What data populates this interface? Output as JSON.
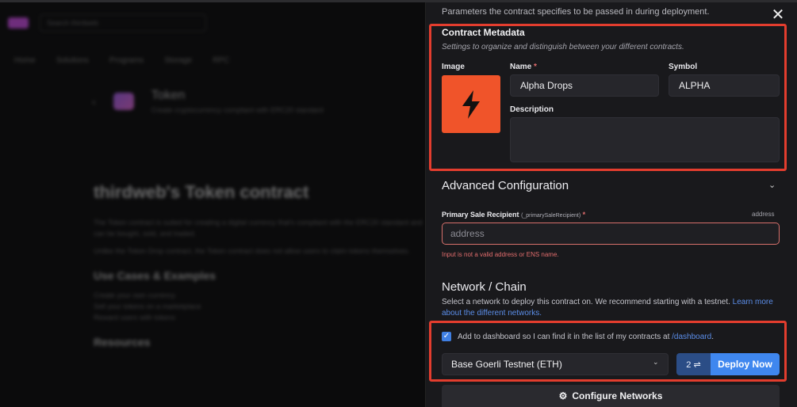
{
  "background": {
    "search_placeholder": "Search thirdweb",
    "nav": [
      "Home",
      "Solutions",
      "Programs",
      "Storage",
      "RPC"
    ],
    "token_title": "Token",
    "token_sub": "Create cryptocurrency compliant with ERC20 standard",
    "heading": "thirdweb's Token contract",
    "para1": "The Token contract is suited for creating a digital currency that's compliant with the ERC20 standard and can be bought, sold, and traded.",
    "para2": "Unlike the Token Drop contract, the Token contract does not allow users to claim tokens themselves.",
    "section": "Use Cases & Examples",
    "list": [
      "Create your own currency",
      "Sell your tokens on a marketplace",
      "Reward users with tokens"
    ],
    "resources": "Resources"
  },
  "panel": {
    "intro": "Parameters the contract specifies to be passed in during deployment.",
    "close_icon": "close-icon",
    "metadata": {
      "title": "Contract Metadata",
      "subtitle": "Settings to organize and distinguish between your different contracts.",
      "image_label": "Image",
      "image_icon": "lightning-icon",
      "name_label": "Name",
      "required_mark": "*",
      "name_value": "Alpha Drops",
      "symbol_label": "Symbol",
      "symbol_value": "ALPHA",
      "description_label": "Description",
      "description_value": ""
    },
    "advanced": {
      "title": "Advanced Configuration",
      "psr_label": "Primary Sale Recipient",
      "psr_param": "(_primarySaleRecipient)",
      "psr_type": "address",
      "psr_placeholder": "address",
      "error": "Input is not a valid address or ENS name."
    },
    "network": {
      "title": "Network / Chain",
      "desc": "Select a network to deploy this contract on. We recommend starting with a testnet.",
      "learn_more": "Learn more about the different networks.",
      "checkbox_label": "Add to dashboard so I can find it in the list of my contracts at",
      "dashboard_link": "/dashboard",
      "selected_chain": "Base Goerli Testnet (ETH)",
      "tx_count": "2 ⇌",
      "deploy_label": "Deploy Now",
      "configure_label": "Configure Networks"
    }
  },
  "colors": {
    "highlight": "#e33d2e",
    "accent": "#3f87ef",
    "image_bg": "#f0542a",
    "error": "#e26d6d"
  }
}
